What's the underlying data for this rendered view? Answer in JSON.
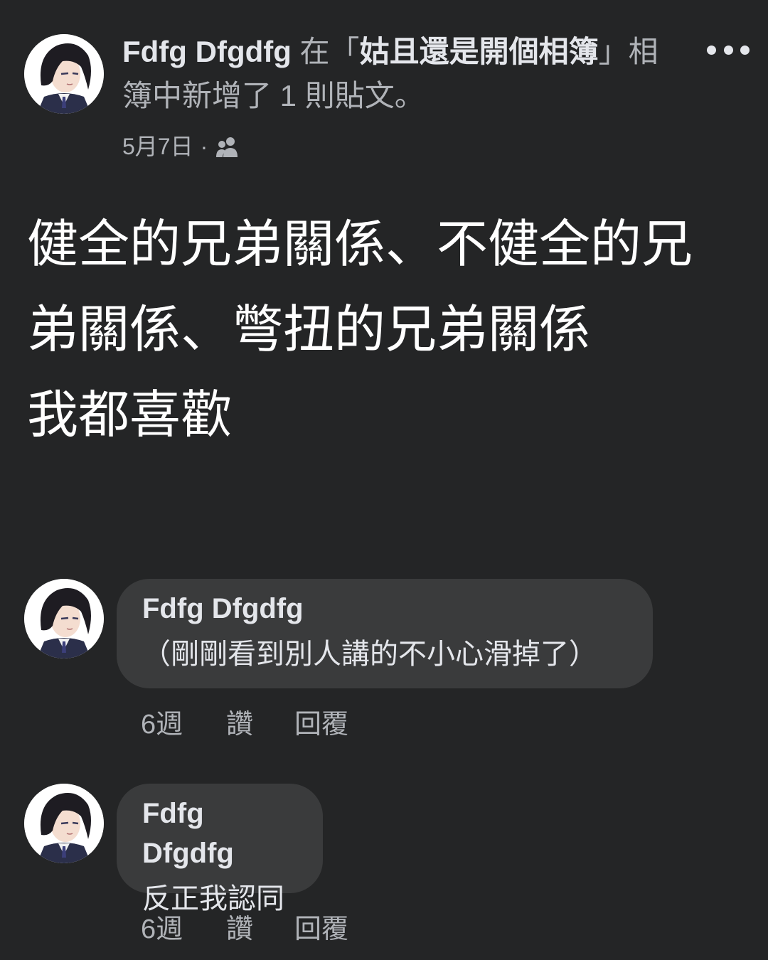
{
  "post": {
    "author": "Fdfg Dfgdfg",
    "action_prefix": " 在「",
    "album_name": "姑且還是開個相簿",
    "action_suffix": "」相簿中新增了 1 則貼文。",
    "date": "5月7日",
    "separator": "·",
    "audience_icon": "friends-icon",
    "more_icon": "more-options-icon",
    "body": "健全的兄弟關係、不健全的兄\n弟關係、彆扭的兄弟關係\n我都喜歡"
  },
  "comments": [
    {
      "author": "Fdfg Dfgdfg",
      "text": "（剛剛看到別人講的不小心滑掉了）",
      "time": "6週",
      "like_label": "讚",
      "reply_label": "回覆"
    },
    {
      "author": "Fdfg Dfgdfg",
      "text": "反正我認同",
      "time": "6週",
      "like_label": "讚",
      "reply_label": "回覆"
    }
  ],
  "colors": {
    "background": "#242526",
    "bubble": "#3a3b3c",
    "primary_text": "#e4e6eb",
    "secondary_text": "#b0b3b8"
  }
}
